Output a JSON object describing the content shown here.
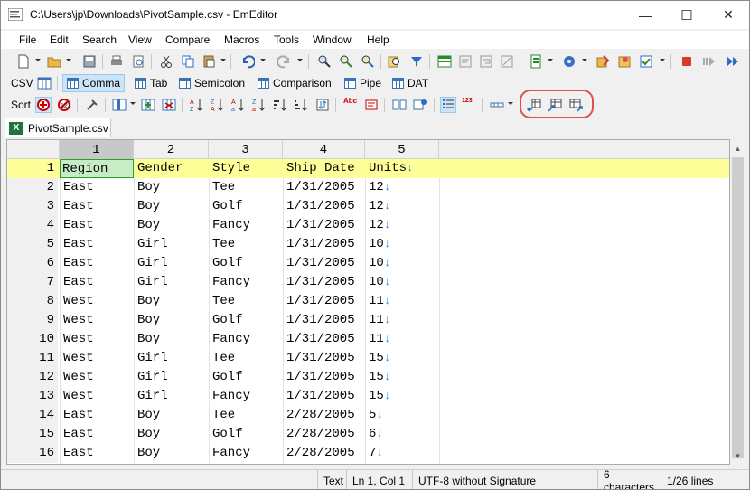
{
  "window": {
    "title": "C:\\Users\\jp\\Downloads\\PivotSample.csv - EmEditor",
    "min": "—",
    "max": "☐",
    "close": "✕"
  },
  "menu": [
    "File",
    "Edit",
    "Search",
    "View",
    "Compare",
    "Macros",
    "Tools",
    "Window",
    "Help"
  ],
  "csv_toolbar": {
    "label": "CSV",
    "modes": [
      "Comma",
      "Tab",
      "Semicolon",
      "Comparison",
      "Pipe",
      "DAT"
    ],
    "selected": "Comma"
  },
  "sort_toolbar": {
    "label": "Sort",
    "abc_label": "Abc",
    "num_label": "123"
  },
  "tab": {
    "icon_text": "X",
    "filename": "PivotSample.csv"
  },
  "grid": {
    "columns": [
      "1",
      "2",
      "3",
      "4",
      "5"
    ],
    "active_column": "1",
    "newline_glyph": "↓",
    "rows": [
      {
        "n": "1",
        "cells": [
          "Region",
          "Gender",
          "Style",
          "Ship Date",
          "Units"
        ]
      },
      {
        "n": "2",
        "cells": [
          "East",
          "Boy",
          "Tee",
          "1/31/2005",
          "12"
        ]
      },
      {
        "n": "3",
        "cells": [
          "East",
          "Boy",
          "Golf",
          "1/31/2005",
          "12"
        ]
      },
      {
        "n": "4",
        "cells": [
          "East",
          "Boy",
          "Fancy",
          "1/31/2005",
          "12"
        ]
      },
      {
        "n": "5",
        "cells": [
          "East",
          "Girl",
          "Tee",
          "1/31/2005",
          "10"
        ]
      },
      {
        "n": "6",
        "cells": [
          "East",
          "Girl",
          "Golf",
          "1/31/2005",
          "10"
        ]
      },
      {
        "n": "7",
        "cells": [
          "East",
          "Girl",
          "Fancy",
          "1/31/2005",
          "10"
        ]
      },
      {
        "n": "8",
        "cells": [
          "West",
          "Boy",
          "Tee",
          "1/31/2005",
          "11"
        ]
      },
      {
        "n": "9",
        "cells": [
          "West",
          "Boy",
          "Golf",
          "1/31/2005",
          "11"
        ]
      },
      {
        "n": "10",
        "cells": [
          "West",
          "Boy",
          "Fancy",
          "1/31/2005",
          "11"
        ]
      },
      {
        "n": "11",
        "cells": [
          "West",
          "Girl",
          "Tee",
          "1/31/2005",
          "15"
        ]
      },
      {
        "n": "12",
        "cells": [
          "West",
          "Girl",
          "Golf",
          "1/31/2005",
          "15"
        ]
      },
      {
        "n": "13",
        "cells": [
          "West",
          "Girl",
          "Fancy",
          "1/31/2005",
          "15"
        ]
      },
      {
        "n": "14",
        "cells": [
          "East",
          "Boy",
          "Tee",
          "2/28/2005",
          "5"
        ]
      },
      {
        "n": "15",
        "cells": [
          "East",
          "Boy",
          "Golf",
          "2/28/2005",
          "6"
        ]
      },
      {
        "n": "16",
        "cells": [
          "East",
          "Boy",
          "Fancy",
          "2/28/2005",
          "7"
        ]
      }
    ]
  },
  "status": {
    "mode": "Text",
    "position": "Ln 1, Col 1",
    "encoding": "UTF-8 without Signature",
    "selection": "6 characters",
    "lines": "1/26 lines"
  },
  "colors": {
    "current_line": "#ffff99",
    "selected_cell": "#c7edc7",
    "newline_mark": "#1a7fd6",
    "highlight_ring": "#d9534f"
  }
}
